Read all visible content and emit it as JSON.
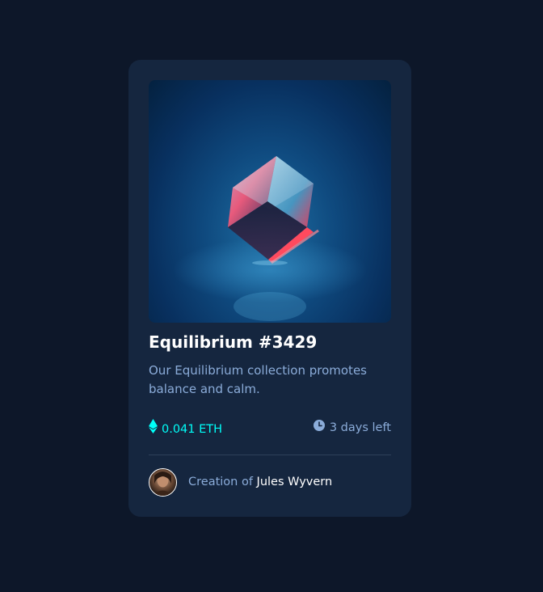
{
  "card": {
    "title": "Equilibrium #3429",
    "description": "Our Equilibrium collection promotes balance and calm.",
    "price": "0.041 ETH",
    "time_left": "3 days left",
    "creator_prefix": "Creation of",
    "creator_name": "Jules Wyvern"
  },
  "icons": {
    "price": "ethereum-icon",
    "time": "clock-icon",
    "avatar": "avatar-portrait"
  },
  "colors": {
    "page_background": "#0d1729",
    "card_background": "#15263f",
    "accent_cyan": "#00fff8",
    "soft_blue": "#8bacd9",
    "white": "#ffffff",
    "divider": "#2e405a"
  }
}
